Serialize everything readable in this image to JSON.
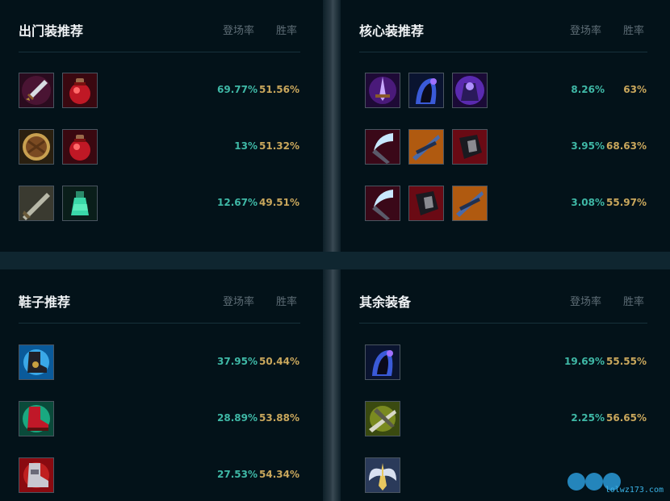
{
  "panels": {
    "starter": {
      "title": "出门装推荐",
      "col_pick": "登场率",
      "col_win": "胜率",
      "rows": [
        {
          "icons": [
            "long-sword-icon",
            "health-potion-icon"
          ],
          "pick": "69.77%",
          "win": "51.56%"
        },
        {
          "icons": [
            "dorans-shield-icon",
            "health-potion-icon"
          ],
          "pick": "13%",
          "win": "51.32%"
        },
        {
          "icons": [
            "blade-icon",
            "refillable-potion-icon"
          ],
          "pick": "12.67%",
          "win": "49.51%"
        }
      ]
    },
    "core": {
      "title": "核心装推荐",
      "col_pick": "登场率",
      "col_win": "胜率",
      "rows": [
        {
          "icons": [
            "purple-sword-icon",
            "purple-hood-icon",
            "purple-armor-icon"
          ],
          "pick": "8.26%",
          "win": "63%"
        },
        {
          "icons": [
            "red-scythe-icon",
            "orange-blades-icon",
            "black-axe-icon"
          ],
          "pick": "3.95%",
          "win": "68.63%"
        },
        {
          "icons": [
            "red-scythe-icon",
            "black-axe-icon",
            "orange-blades-icon"
          ],
          "pick": "3.08%",
          "win": "55.97%"
        }
      ]
    },
    "boots": {
      "title": "鞋子推荐",
      "col_pick": "登场率",
      "col_win": "胜率",
      "rows": [
        {
          "icons": [
            "black-boots-icon"
          ],
          "pick": "37.95%",
          "win": "50.44%"
        },
        {
          "icons": [
            "red-boots-icon"
          ],
          "pick": "28.89%",
          "win": "53.88%"
        },
        {
          "icons": [
            "armored-boots-icon"
          ],
          "pick": "27.53%",
          "win": "54.34%"
        }
      ]
    },
    "other": {
      "title": "其余装备",
      "col_pick": "登场率",
      "col_win": "胜率",
      "rows": [
        {
          "icons": [
            "purple-hood-icon"
          ],
          "pick": "19.69%",
          "win": "55.55%"
        },
        {
          "icons": [
            "green-crossbow-icon"
          ],
          "pick": "2.25%",
          "win": "56.65%"
        },
        {
          "icons": [
            "golden-wings-icon"
          ],
          "pick": "",
          "win": ""
        }
      ]
    }
  },
  "watermark": {
    "text": "lolwz173.com",
    "logo": "LOL"
  },
  "colors": {
    "accent_pick": "#3fb8a6",
    "accent_win": "#c9a75c",
    "panel_bg": "#031219"
  }
}
